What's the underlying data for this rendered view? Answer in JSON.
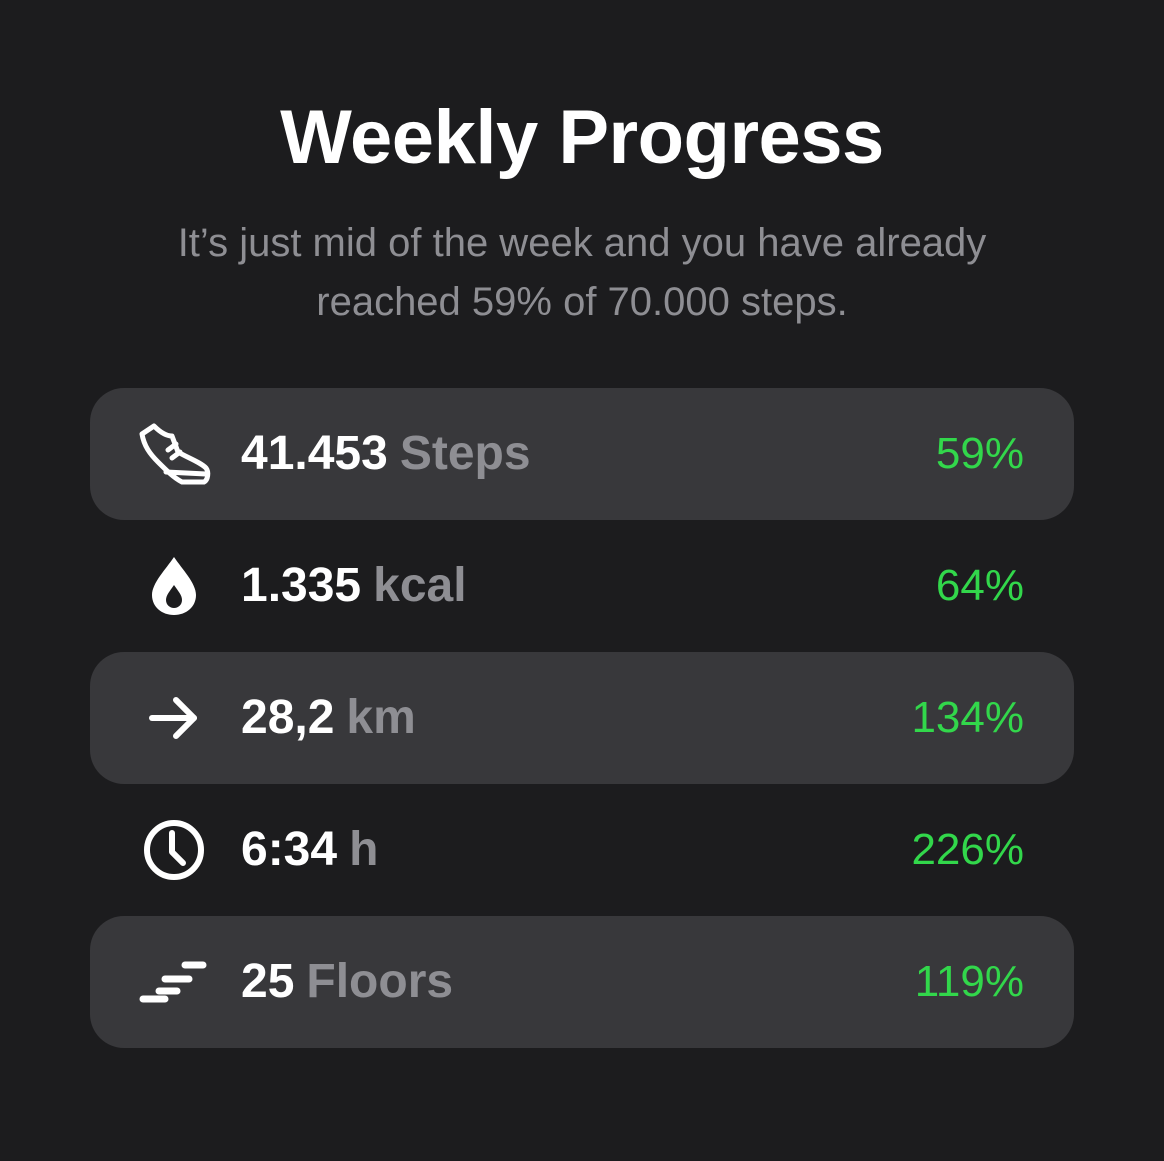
{
  "header": {
    "title": "Weekly Progress",
    "subtitle": "It’s just mid of the week and you have already reached 59% of 70.000 steps."
  },
  "colors": {
    "background": "#1c1c1e",
    "row_highlight": "#38383b",
    "secondary_text": "#8e8e93",
    "accent_green": "#32d74b"
  },
  "metrics": [
    {
      "icon": "sneaker-icon",
      "value": "41.453",
      "unit": "Steps",
      "percent": "59%"
    },
    {
      "icon": "drop-icon",
      "value": "1.335",
      "unit": "kcal",
      "percent": "64%"
    },
    {
      "icon": "arrow-right-icon",
      "value": "28,2",
      "unit": "km",
      "percent": "134%"
    },
    {
      "icon": "clock-icon",
      "value": "6:34",
      "unit": "h",
      "percent": "226%"
    },
    {
      "icon": "stairs-icon",
      "value": "25",
      "unit": "Floors",
      "percent": "119%"
    }
  ]
}
